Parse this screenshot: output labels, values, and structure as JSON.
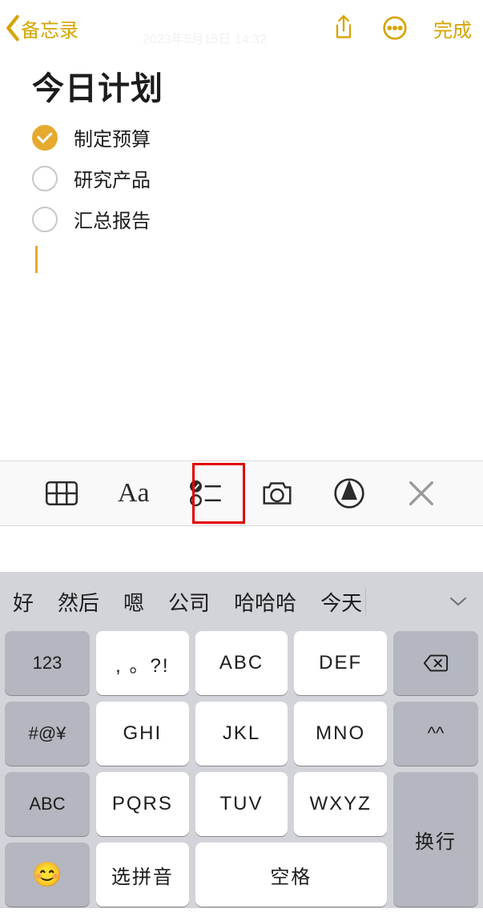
{
  "nav": {
    "back_label": "备忘录",
    "timestamp": "2023年5月15日 14:32",
    "done_label": "完成"
  },
  "note": {
    "title": "今日计划",
    "items": [
      {
        "text": "制定预算",
        "checked": true
      },
      {
        "text": "研究产品",
        "checked": false
      },
      {
        "text": "汇总报告",
        "checked": false
      }
    ]
  },
  "format_toolbar": {
    "aa_label": "Aa"
  },
  "keyboard": {
    "candidates": [
      "好",
      "然后",
      "嗯",
      "公司",
      "哈哈哈",
      "今天"
    ],
    "rows": [
      [
        "123",
        ", 。?!",
        "ABC",
        "DEF"
      ],
      [
        "#@¥",
        "GHI",
        "JKL",
        "MNO",
        "^^"
      ],
      [
        "ABC",
        "PQRS",
        "TUV",
        "WXYZ"
      ],
      [
        "😊",
        "选拼音",
        "空格"
      ]
    ],
    "enter_label": "换行",
    "caret_label": "^^"
  }
}
